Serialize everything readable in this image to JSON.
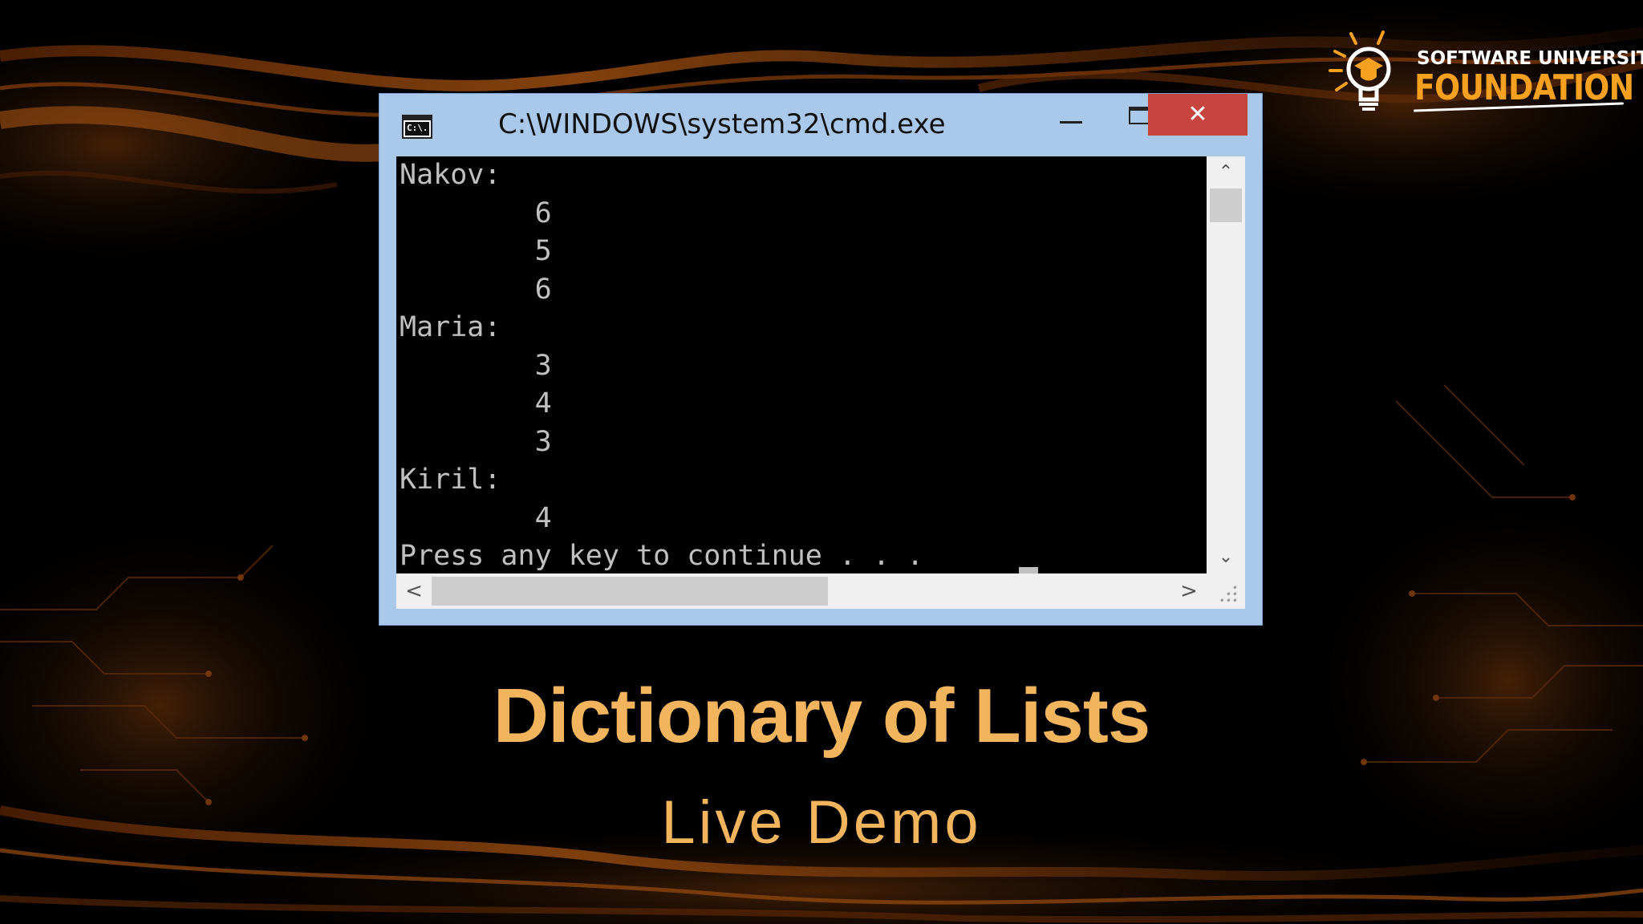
{
  "logo": {
    "line1": "SOFTWARE UNIVERSITY",
    "line2": "FOUNDATION",
    "icon": "lightbulb-graduate-icon"
  },
  "window": {
    "title": "C:\\WINDOWS\\system32\\cmd.exe",
    "app_icon_text": "C:\\.",
    "minimize_glyph": "",
    "maximize_glyph": "",
    "close_glyph": "✕"
  },
  "console": {
    "lines": [
      "Nakov:",
      "        6",
      "        5",
      "        6",
      "Maria:",
      "        3",
      "        4",
      "        3",
      "Kiril:",
      "        4",
      "Press any key to continue . . ."
    ],
    "vertical_scroll_position": 0.02,
    "horizontal_scroll_fraction": 0.53
  },
  "scrollbars": {
    "up": "⌃",
    "down": "⌄",
    "left": "<",
    "right": ">"
  },
  "slide": {
    "title": "Dictionary of Lists",
    "subtitle": "Live Demo"
  },
  "colors": {
    "accent": "#f2b45c",
    "brand_orange": "#f6a020",
    "console_bg": "#000000",
    "console_text": "#c0c0c0",
    "window_frame": "#a9c8ea",
    "close_button": "#c7443f"
  }
}
